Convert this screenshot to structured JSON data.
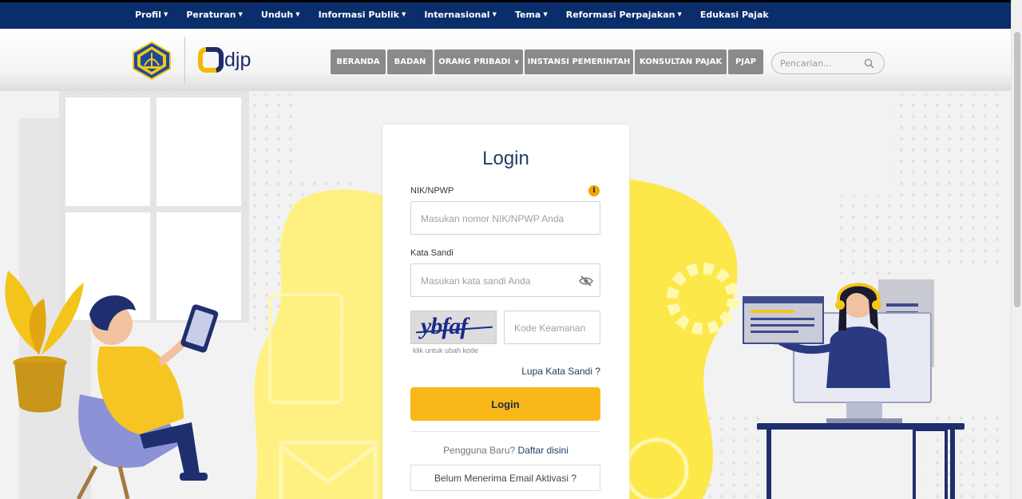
{
  "topnav": {
    "items": [
      {
        "label": "Profil"
      },
      {
        "label": "Peraturan"
      },
      {
        "label": "Unduh"
      },
      {
        "label": "Informasi Publik"
      },
      {
        "label": "Internasional"
      },
      {
        "label": "Tema"
      },
      {
        "label": "Reformasi Perpajakan"
      },
      {
        "label": "Edukasi Pajak"
      }
    ]
  },
  "header": {
    "logo_text": "djp",
    "menu": [
      {
        "label": "BERANDA"
      },
      {
        "label": "BADAN"
      },
      {
        "label": "ORANG PRIBADI"
      },
      {
        "label": "INSTANSI PEMERINTAH"
      },
      {
        "label": "KONSULTAN PAJAK"
      },
      {
        "label": "PJAP"
      }
    ],
    "search_placeholder": "Pencarian..."
  },
  "login": {
    "title": "Login",
    "nik_label": "NIK/NPWP",
    "nik_placeholder": "Masukan nomor NIK/NPWP Anda",
    "password_label": "Kata Sandi",
    "password_placeholder": "Masukan kata sandi Anda",
    "captcha_text": "ybfaf",
    "captcha_note": "klik untuk ubah kode",
    "captcha_placeholder": "Kode Keamanan",
    "forgot": "Lupa Kata Sandi ?",
    "submit": "Login",
    "new_user_text": "Pengguna Baru?",
    "register_link": "Daftar disini",
    "activation": "Belum Menerima Email Aktivasi ?"
  },
  "colors": {
    "nav_bg": "#0a2d6b",
    "accent_yellow": "#f9b719",
    "title_blue": "#1d3f63",
    "menu_gray": "#8a8a8a"
  }
}
